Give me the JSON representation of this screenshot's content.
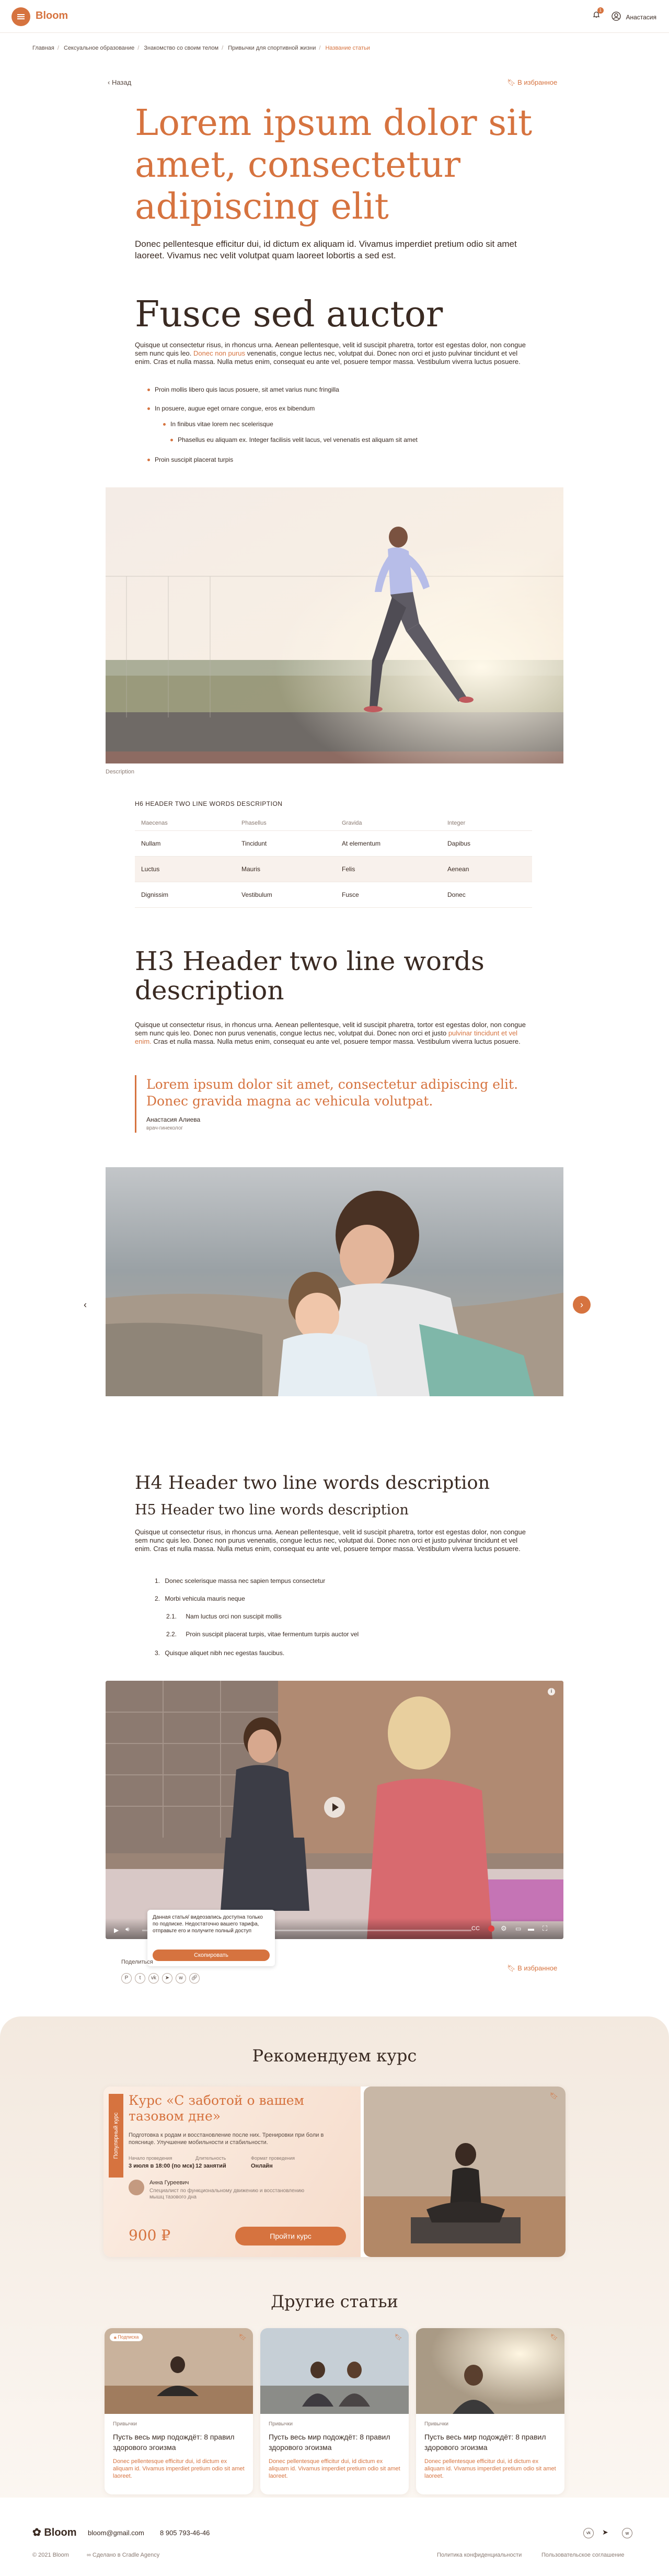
{
  "header": {
    "logo": "Bloom",
    "user": "Анастасия",
    "notifications": "1"
  },
  "breadcrumb": [
    "Главная",
    "Сексуальное образование",
    "Знакомство со своим телом",
    "Привычки для спортивной жизни"
  ],
  "breadcrumb_current": "Название статьи",
  "nav": {
    "back": "Назад",
    "favorite": "В избранное"
  },
  "article": {
    "title": "Lorem ipsum dolor sit amet, consectetur adipiscing elit",
    "lead": "Donec pellentesque efficitur dui, id dictum ex aliquam id. Vivamus imperdiet pretium odio sit amet laoreet. Vivamus nec velit volutpat quam laoreet lobortis a sed est.",
    "h2": "Fusce sed auctor",
    "p1a": "Quisque ut consectetur risus, in rhoncus urna. Aenean pellentesque, velit id suscipit pharetra, tortor est egestas dolor, non congue sem nunc quis leo.",
    "p1_link": "Donec non purus",
    "p1b": "venenatis, congue lectus nec, volutpat dui. Donec non orci et justo pulvinar tincidunt et vel enim. Cras et nulla massa. Nulla metus enim, consequat eu ante vel, posuere tempor massa. Vestibulum viverra luctus posuere.",
    "bullets": [
      "Proin mollis libero quis lacus posuere, sit amet varius nunc fringilla",
      "In posuere, augue eget ornare congue, eros ex bibendum",
      "In finibus vitae lorem nec scelerisque",
      "Phasellus eu aliquam ex. Integer facilisis velit lacus, vel venenatis est aliquam sit amet",
      "Proin suscipit placerat turpis"
    ],
    "image_caption": "Description",
    "table_caption": "H6 HEADER TWO LINE WORDS DESCRIPTION",
    "table_headers": [
      "Maecenas",
      "Phasellus",
      "Gravida",
      "Integer"
    ],
    "table_rows": [
      [
        "Nullam",
        "Tincidunt",
        "At elementum",
        "Dapibus"
      ],
      [
        "Luctus",
        "Mauris",
        "Felis",
        "Aenean"
      ],
      [
        "Dignissim",
        "Vestibulum",
        "Fusce",
        "Donec"
      ]
    ],
    "h3": "H3 Header two line words description",
    "p2a": "Quisque ut consectetur risus, in rhoncus urna. Aenean pellentesque, velit id suscipit pharetra, tortor est egestas dolor, non congue sem nunc quis leo. Donec non purus venenatis, congue lectus nec, volutpat dui. Donec non orci et justo",
    "p2_link": "pulvinar tincidunt et vel enim.",
    "p2b": "Cras et nulla massa. Nulla metus enim, consequat eu ante vel, posuere tempor massa. Vestibulum viverra luctus posuere.",
    "quote": "Lorem ipsum dolor sit amet, consectetur adipiscing elit. Donec gravida magna ac vehicula volutpat.",
    "quote_author": "Анастасия Алиева",
    "quote_role": "врач-гинеколог",
    "h4": "H4 Header two line words description",
    "h5": "H5 Header two line words description",
    "p3": "Quisque ut consectetur risus, in rhoncus urna. Aenean pellentesque, velit id suscipit pharetra, tortor est egestas dolor, non congue sem nunc quis leo. Donec non purus venenatis, congue lectus nec, volutpat dui. Donec non orci et justo pulvinar tincidunt et vel enim. Cras et nulla massa. Nulla metus enim, consequat eu ante vel, posuere tempor massa. Vestibulum viverra luctus posuere.",
    "numbered": [
      {
        "n": "1.",
        "t": "Donec scelerisque massa nec sapien tempus consectetur"
      },
      {
        "n": "2.",
        "t": "Morbi vehicula mauris neque"
      },
      {
        "n": "2.1.",
        "t": "Nam luctus orci non suscipit mollis"
      },
      {
        "n": "2.2.",
        "t": "Proin suscipit placerat turpis, vitae fermentum turpis auctor vel"
      },
      {
        "n": "3.",
        "t": "Quisque aliquet nibh nec egestas faucibus."
      }
    ],
    "video_popup": "Данная статья/ видеозапись доступна только по подписке. Недостаточно вашего тарифа, отправьте его и получите полный доступ",
    "video_popup_btn": "Скопировать",
    "share_label": "Поделиться",
    "favorite_bottom": "В избранное"
  },
  "recommend": {
    "title": "Рекомендуем курс",
    "badge": "Популярный курс",
    "course_title": "Курс «С заботой о вашем тазовом дне»",
    "course_desc": "Подготовка к родам и восстановление после них. Тренировки при боли в пояснице. Улучшение мобильности и стабильности.",
    "meta_labels": [
      "Начало проведения",
      "Длительность",
      "Формат проведения"
    ],
    "meta_values": [
      "3 июля в 18:00 (по мск)",
      "12 занятий",
      "Онлайн"
    ],
    "author_name": "Анна Гуреевич",
    "author_role": "Специалист по функциональному движению и восстановлению мышц тазового дна",
    "price": "900 ₽",
    "cta": "Пройти курс"
  },
  "other": {
    "title": "Другие статьи",
    "cards": [
      {
        "tag": "Подписка",
        "cat": "Привычки",
        "title": "Пусть весь мир подождёт: 8 правил здорового эгоизма",
        "desc": "Donec pellentesque efficitur dui, id dictum ex aliquam id. Vivamus imperdiet pretium odio sit amet laoreet."
      },
      {
        "tag": "",
        "cat": "Привычки",
        "title": "Пусть весь мир подождёт: 8 правил здорового эгоизма",
        "desc": "Donec pellentesque efficitur dui, id dictum ex aliquam id. Vivamus imperdiet pretium odio sit amet laoreet."
      },
      {
        "tag": "",
        "cat": "Привычки",
        "title": "Пусть весь мир подождёт: 8 правил здорового эгоизма",
        "desc": "Donec pellentesque efficitur dui, id dictum ex aliquam id. Vivamus imperdiet pretium odio sit amet laoreet."
      }
    ]
  },
  "footer": {
    "logo": "Bloom",
    "email": "bloom@gmail.com",
    "phone": "8 905 793-46-46",
    "copyright": "© 2021 Bloom",
    "agency": "Сделано в Cradle Agency",
    "privacy": "Политика конфиденциальности",
    "terms": "Пользовательское соглашение"
  },
  "colors": {
    "accent": "#d6733f",
    "text": "#3a2a22",
    "section_bg": "#f3e9df"
  }
}
